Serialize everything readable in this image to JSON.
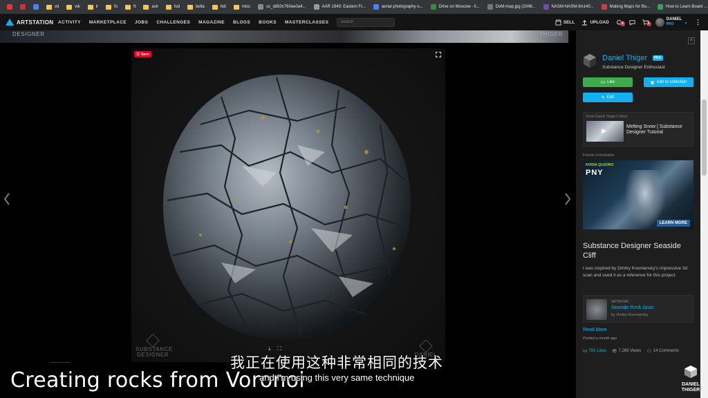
{
  "bookmarks": [
    {
      "label": "",
      "color": "#e33"
    },
    {
      "label": "",
      "color": "#c33"
    },
    {
      "label": "",
      "color": "#4285f4"
    },
    {
      "label": "vd",
      "folder": true
    },
    {
      "label": "wk",
      "folder": true
    },
    {
      "label": "lr",
      "folder": true
    },
    {
      "label": "fo",
      "folder": true
    },
    {
      "label": "ft",
      "folder": true
    },
    {
      "label": "avk",
      "folder": true
    },
    {
      "label": "fud",
      "folder": true
    },
    {
      "label": "bella",
      "folder": true
    },
    {
      "label": "hdi",
      "folder": true
    },
    {
      "label": "misc",
      "folder": true
    },
    {
      "label": "ss_dd50c760ee0a4...",
      "color": "#888"
    },
    {
      "label": "AAR 1943: Eastern Fr...",
      "color": "#999"
    },
    {
      "label": "aerial photography-s...",
      "color": "#4285f4"
    },
    {
      "label": "Drive on Moscow - li...",
      "color": "#3b8b3b"
    },
    {
      "label": "DoM-map.jpg (2048...",
      "color": "#777"
    },
    {
      "label": "NASM-NASM-9A140...",
      "color": "#6d4fb3"
    },
    {
      "label": "Making Maps for Bo...",
      "color": "#c94040"
    },
    {
      "label": "How to Learn Board ...",
      "color": "#3aa055"
    }
  ],
  "header": {
    "logo": "ARTSTATION",
    "nav": [
      "ACTIVITY",
      "MARKETPLACE",
      "JOBS",
      "CHALLENGES",
      "MAGAZINE",
      "BLOGS",
      "BOOKS",
      "MASTERCLASSES"
    ],
    "search_placeholder": "Search",
    "sell": "SELL",
    "upload": "UPLOAD",
    "notif_count": "4",
    "cart_count": "1",
    "user_name": "DANIEL",
    "user_badge": "PRO"
  },
  "viewer": {
    "strip_left": "DESIGNER",
    "strip_right": "THIGER",
    "pin_label": "Save",
    "wm_left": "SUBSTANCE\nDESIGNER",
    "wm_right": "DANIEL"
  },
  "panel": {
    "author_name": "Daniel Thiger",
    "author_badge": "PRO",
    "author_role": "Substance Designer Enthusiast",
    "like": "Like",
    "add_collection": "Add to collection",
    "edit": "Edit",
    "store_caption": "From Daniel Thiger's Store",
    "store_title": "Melting Snow | Substance Designer Tutorial",
    "friends": "Friends of ArtStation",
    "ad_brand": "NVIDIA QUADRO",
    "ad_name": "PNY",
    "ad_cta": "LEARN MORE",
    "title": "Substance Designer Seaside Cliff",
    "description": "I was inspired by Dmitry Kremiansky's impressive 3d scan and used it as a reference for this project.",
    "ref_kind": "ARTWORK",
    "ref_title": "Seaside Rock Scan",
    "ref_by": "by Dmitry Kremiansky",
    "read_more": "Read More",
    "posted": "Posted a month ago",
    "likes": "781 Likes",
    "views": "7,265 Views",
    "comments": "14 Comments"
  },
  "overlay": {
    "subtitle_cn": "我正在使用这种非常相同的技术",
    "subtitle_en": "and I'm using this very same technique",
    "caption": "Creating rocks from Voronoi",
    "channel_line1": "DANIEL",
    "channel_line2": "THIGER"
  },
  "colors": {
    "accent": "#13aff0",
    "like_green": "#3bab4c",
    "pin_red": "#e60023"
  }
}
